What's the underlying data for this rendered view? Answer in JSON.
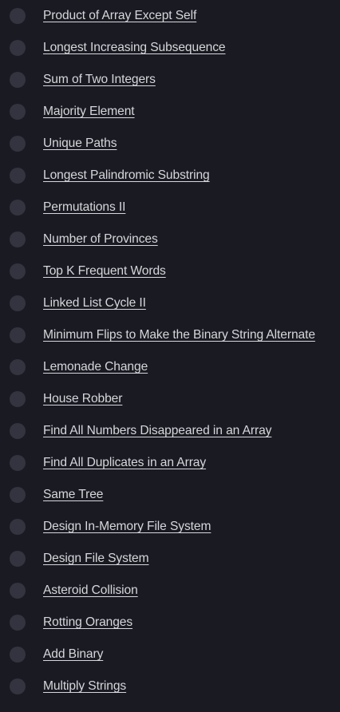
{
  "problems": [
    {
      "title": "Product of Array Except Self"
    },
    {
      "title": "Longest Increasing Subsequence"
    },
    {
      "title": "Sum of Two Integers"
    },
    {
      "title": "Majority Element"
    },
    {
      "title": "Unique Paths"
    },
    {
      "title": "Longest Palindromic Substring"
    },
    {
      "title": "Permutations II"
    },
    {
      "title": "Number of Provinces"
    },
    {
      "title": "Top K Frequent Words"
    },
    {
      "title": "Linked List Cycle II"
    },
    {
      "title": "Minimum Flips to Make the Binary String Alternate"
    },
    {
      "title": "Lemonade Change"
    },
    {
      "title": "House Robber"
    },
    {
      "title": "Find All Numbers Disappeared in an Array"
    },
    {
      "title": "Find All Duplicates in an Array"
    },
    {
      "title": "Same Tree"
    },
    {
      "title": "Design In-Memory File System"
    },
    {
      "title": "Design File System"
    },
    {
      "title": "Asteroid Collision"
    },
    {
      "title": "Rotting Oranges"
    },
    {
      "title": "Add Binary"
    },
    {
      "title": "Multiply Strings"
    }
  ],
  "colors": {
    "background": "#1a1a22",
    "status_circle": "#343440",
    "link_text": "#d6d6dc"
  }
}
